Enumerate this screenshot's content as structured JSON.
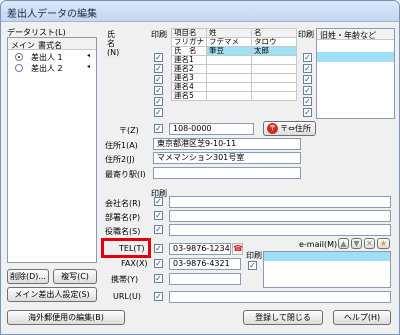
{
  "window": {
    "title": "差出人データの編集"
  },
  "list": {
    "label": "データリスト(L)",
    "col_main": "メイン",
    "col_name": "書式名",
    "items": [
      {
        "name": "差出人 1",
        "selected": true
      },
      {
        "name": "差出人 2",
        "selected": false
      }
    ]
  },
  "name_block": {
    "label": "氏　名(N)",
    "print_label": "印刷",
    "headers": [
      "項目名",
      "姓",
      "名"
    ],
    "rows": [
      [
        "フリガナ",
        "フデマメ",
        "タロウ"
      ],
      [
        "氏　名",
        "筆豆",
        "太郎"
      ],
      [
        "連名1",
        "",
        ""
      ],
      [
        "連名2",
        "",
        ""
      ],
      [
        "連名3",
        "",
        ""
      ],
      [
        "連名4",
        "",
        ""
      ],
      [
        "連名5",
        "",
        ""
      ]
    ],
    "print2_label": "印刷",
    "old_col": "旧姓・年齢など"
  },
  "address": {
    "zip_label": "〒(Z)",
    "zip": "108-0000",
    "zip_btn": "〒⇔住所",
    "addr1_label": "住所1(A)",
    "addr1": "東京都港区芝9-10-11",
    "addr2_label": "住所2(J)",
    "addr2": "マメマンション301号室",
    "station_label": "最寄り駅(I)"
  },
  "org": {
    "print_label": "印刷",
    "company_label": "会社名(R)",
    "dept_label": "部署名(P)",
    "title_label": "役職名(S)"
  },
  "contact": {
    "tel_label": "TEL(T)",
    "tel": "03-9876-1234",
    "fax_label": "FAX(X)",
    "fax": "03-9876-4321",
    "mobile_label": "携帯(Y)",
    "url_label": "URL(U)",
    "print_label": "印刷",
    "email_label": "e-mail(M)"
  },
  "buttons": {
    "delete": "削除(D)...",
    "copy": "複写(C)",
    "main_sender": "メイン差出人設定(S)",
    "overseas": "海外郵便用の編集(B)",
    "register": "登録して閉じる",
    "help": "ヘルプ(H)"
  },
  "highlight_color": "#e3000f"
}
